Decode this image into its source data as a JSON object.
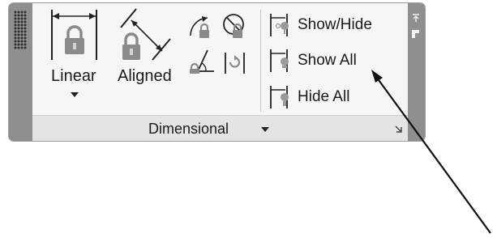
{
  "panel": {
    "title": "Dimensional",
    "dropdown_icon": "caret-down-icon",
    "launcher_icon": "dialog-launcher-icon"
  },
  "tools": {
    "linear": {
      "label": "Linear",
      "icon": "linear-dimension-lock-icon",
      "has_dropdown": true
    },
    "aligned": {
      "label": "Aligned",
      "icon": "aligned-dimension-lock-icon"
    },
    "small": [
      {
        "icon": "angular-lock-icon"
      },
      {
        "icon": "diameter-lock-icon"
      },
      {
        "icon": "angle-lock-icon"
      },
      {
        "icon": "radial-rotate-icon"
      }
    ]
  },
  "visibility": {
    "items": [
      {
        "label": "Show/Hide",
        "icon": "show-hide-icon"
      },
      {
        "label": "Show All",
        "icon": "show-all-icon"
      },
      {
        "label": "Hide All",
        "icon": "hide-all-icon"
      }
    ]
  },
  "annotation": {
    "icon": "callout-arrow-icon"
  },
  "colors": {
    "panel_bg": "#f6f6f6",
    "grip": "#8f8f8f",
    "footer_bg": "#e4e4e4",
    "icon_gray": "#8a8a8a",
    "text": "#1a1a1a"
  }
}
